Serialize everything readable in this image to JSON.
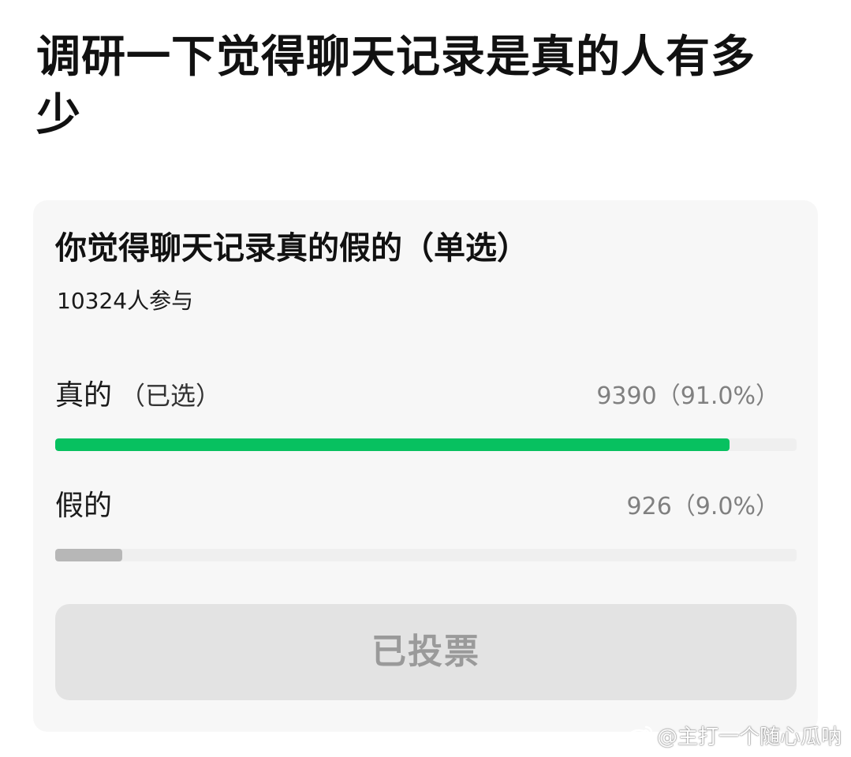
{
  "post": {
    "title": "调研一下觉得聊天记录是真的人有多少"
  },
  "poll": {
    "question": "你觉得聊天记录真的假的（单选）",
    "participants": "10324人参与",
    "options": [
      {
        "label": "真的",
        "selected_tag": "（已选）",
        "result": "9390（91.0%）",
        "count": 9390,
        "fraction": 0.91,
        "selected": true
      },
      {
        "label": "假的",
        "selected_tag": "",
        "result": "926（9.0%）",
        "count": 926,
        "fraction": 0.09,
        "selected": false
      }
    ],
    "button_label": "已投票",
    "colors": {
      "selected_bar": "#07c160",
      "other_bar": "#b7b7b7",
      "track": "#efefef",
      "card_bg": "#f7f7f7",
      "button_bg": "#e3e3e3"
    }
  },
  "watermark": {
    "icon": "weibo-icon",
    "text": "@主打一个随心瓜呐"
  }
}
